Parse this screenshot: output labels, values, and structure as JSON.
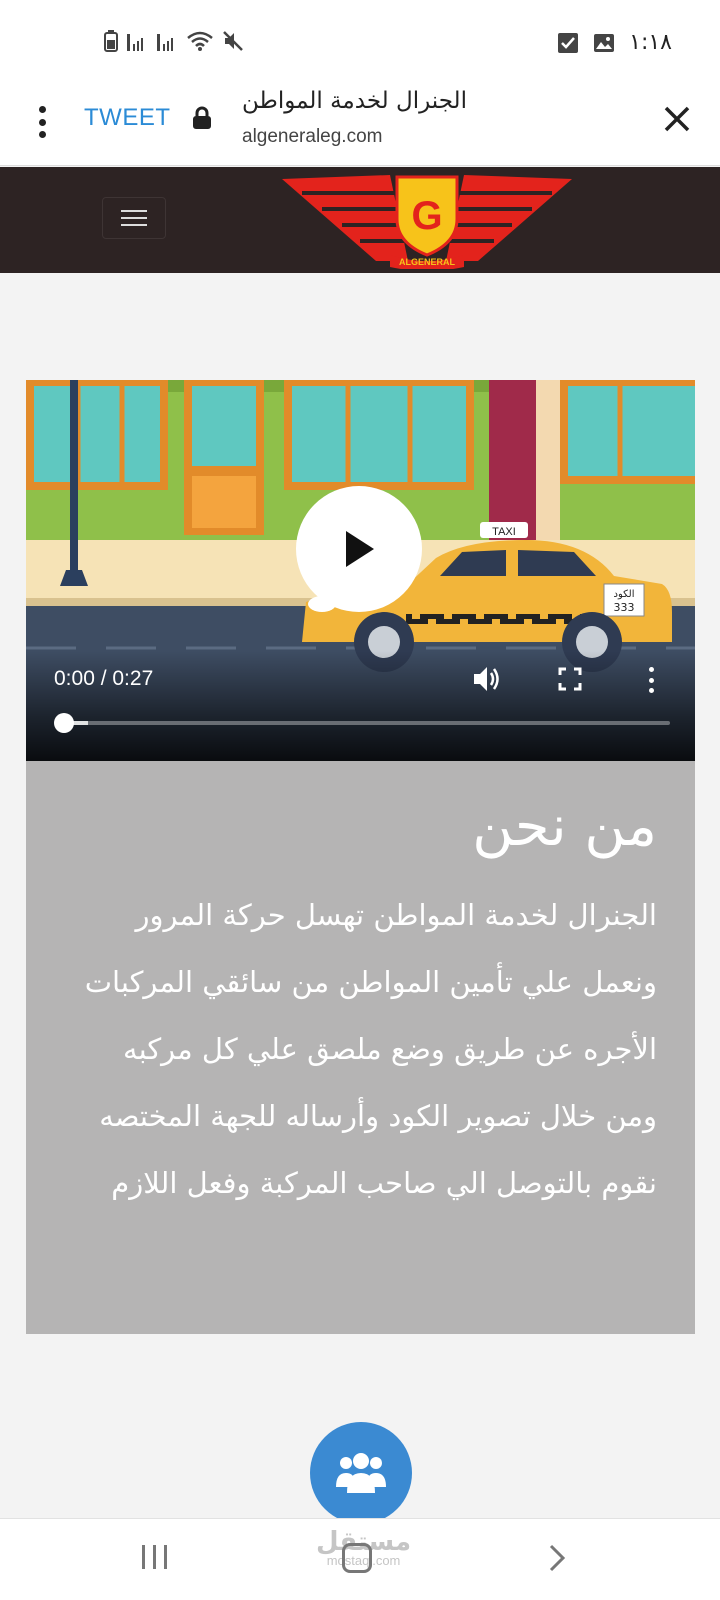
{
  "status_bar": {
    "time": "١:١٨",
    "icons": [
      "battery-icon",
      "signal-icon",
      "signal-icon",
      "wifi-icon",
      "mute-icon",
      "checkbox-notification-icon",
      "image-notification-icon"
    ]
  },
  "browser": {
    "menu_icon": "more-vert-icon",
    "tweet_label": "TWEET",
    "lock_icon": "lock-icon",
    "title": "الجنرال لخدمة المواطن",
    "domain": "algeneraleg.com",
    "close_icon": "close-icon"
  },
  "site_header": {
    "menu_icon": "hamburger-icon",
    "logo_letter": "G",
    "logo_text": "ALGENERAL",
    "bg_color": "#2d2323",
    "logo_color": "#e3231c",
    "shield_color": "#f7c31a"
  },
  "video": {
    "time_display": "0:00 / 0:27",
    "progress": 0,
    "taxi_sign": "TAXI",
    "plate_line1": "الكود",
    "plate_line2": "333",
    "icons": [
      "play-icon",
      "volume-icon",
      "fullscreen-icon",
      "more-vert-icon"
    ]
  },
  "about": {
    "title": "من نحن",
    "body": "الجنرال لخدمة المواطن تهسل حركة المرور ونعمل علي تأمين المواطن من سائقي المركبات الأجره عن طريق وضع ملصق علي كل مركبه ومن خلال تصوير الكود وأرساله للجهة المختصه نقوم بالتوصل الي صاحب المركبة وفعل اللازم",
    "bg_color": "#b5b4b4"
  },
  "fab": {
    "icon": "users-icon",
    "color": "#3b8ad2"
  },
  "nav_bar": {
    "icons": [
      "recent-apps-icon",
      "home-icon",
      "back-icon"
    ],
    "watermark_ar": "مستقل",
    "watermark_en": "mostaql.com"
  }
}
